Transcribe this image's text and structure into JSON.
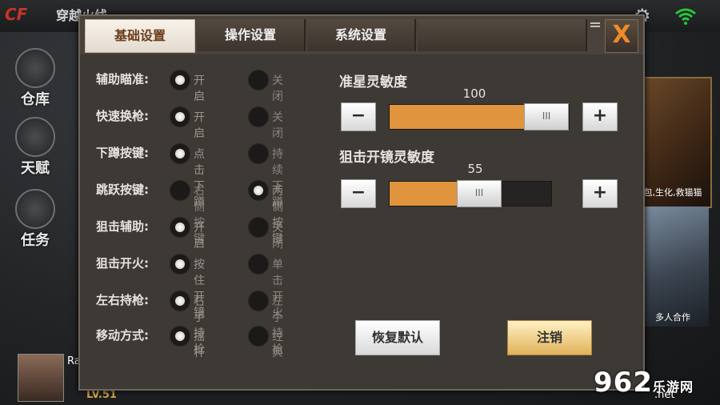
{
  "background": {
    "logo_text": "CF",
    "logo_sub": "穿越火线",
    "nav": [
      {
        "label": "仓库"
      },
      {
        "label": "天赋"
      },
      {
        "label": "任务"
      }
    ],
    "promo1_text": "包,生化,救猫猫",
    "promo2_text": "多人合作",
    "player_prefix": "Ra",
    "level": "LV.51",
    "watermark": "962",
    "watermark_suffix": "乐游网",
    "watermark_domain": ".net",
    "icons": {
      "settings": "gear-icon",
      "network": "wifi-icon"
    },
    "wifi_color": "#27c83a"
  },
  "tabs": [
    {
      "label": "基础设置",
      "active": true
    },
    {
      "label": "操作设置",
      "active": false
    },
    {
      "label": "系统设置",
      "active": false
    },
    {
      "label": "",
      "active": false
    }
  ],
  "close_label": "X",
  "settings": [
    {
      "label": "辅助瞄准:",
      "options": [
        "开启",
        "关闭"
      ],
      "selected": 0
    },
    {
      "label": "快速换枪:",
      "options": [
        "开启",
        "关闭"
      ],
      "selected": 0
    },
    {
      "label": "下蹲按键:",
      "options": [
        "点击下蹲",
        "持续下蹲"
      ],
      "selected": 0
    },
    {
      "label": "跳跃按键:",
      "options": [
        "右侧按键",
        "两侧按键"
      ],
      "selected": 1
    },
    {
      "label": "狙击辅助:",
      "options": [
        "开启",
        "关闭"
      ],
      "selected": 0
    },
    {
      "label": "狙击开火:",
      "options": [
        "按住开镜",
        "单击开火"
      ],
      "selected": 0
    },
    {
      "label": "左右持枪:",
      "options": [
        "右手持枪",
        "左手持枪"
      ],
      "selected": 0
    },
    {
      "label": "移动方式:",
      "options": [
        "摇杆",
        "经典"
      ],
      "selected": 0
    }
  ],
  "sensitivity": [
    {
      "title": "准星灵敏度",
      "value": "100",
      "fraction": 1.0,
      "minus": "−",
      "plus": "+"
    },
    {
      "title": "狙击开镜灵敏度",
      "value": "55",
      "fraction": 0.55,
      "minus": "−",
      "plus": "+"
    }
  ],
  "thumb_grip": "III",
  "buttons": {
    "reset": "恢复默认",
    "logout": "注销"
  },
  "colors": {
    "accent": "#e0943e",
    "close": "#f08a2a"
  }
}
